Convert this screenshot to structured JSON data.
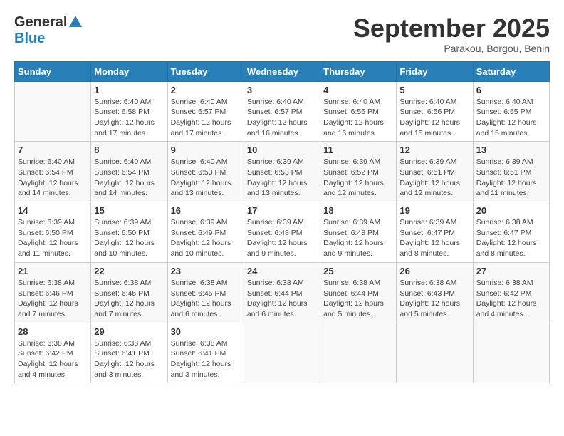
{
  "logo": {
    "general": "General",
    "blue": "Blue"
  },
  "title": {
    "month": "September 2025",
    "location": "Parakou, Borgou, Benin"
  },
  "headers": [
    "Sunday",
    "Monday",
    "Tuesday",
    "Wednesday",
    "Thursday",
    "Friday",
    "Saturday"
  ],
  "weeks": [
    [
      {
        "day": "",
        "info": ""
      },
      {
        "day": "1",
        "info": "Sunrise: 6:40 AM\nSunset: 6:58 PM\nDaylight: 12 hours\nand 17 minutes."
      },
      {
        "day": "2",
        "info": "Sunrise: 6:40 AM\nSunset: 6:57 PM\nDaylight: 12 hours\nand 17 minutes."
      },
      {
        "day": "3",
        "info": "Sunrise: 6:40 AM\nSunset: 6:57 PM\nDaylight: 12 hours\nand 16 minutes."
      },
      {
        "day": "4",
        "info": "Sunrise: 6:40 AM\nSunset: 6:56 PM\nDaylight: 12 hours\nand 16 minutes."
      },
      {
        "day": "5",
        "info": "Sunrise: 6:40 AM\nSunset: 6:56 PM\nDaylight: 12 hours\nand 15 minutes."
      },
      {
        "day": "6",
        "info": "Sunrise: 6:40 AM\nSunset: 6:55 PM\nDaylight: 12 hours\nand 15 minutes."
      }
    ],
    [
      {
        "day": "7",
        "info": ""
      },
      {
        "day": "8",
        "info": "Sunrise: 6:40 AM\nSunset: 6:54 PM\nDaylight: 12 hours\nand 14 minutes."
      },
      {
        "day": "9",
        "info": "Sunrise: 6:40 AM\nSunset: 6:53 PM\nDaylight: 12 hours\nand 13 minutes."
      },
      {
        "day": "10",
        "info": "Sunrise: 6:39 AM\nSunset: 6:53 PM\nDaylight: 12 hours\nand 13 minutes."
      },
      {
        "day": "11",
        "info": "Sunrise: 6:39 AM\nSunset: 6:52 PM\nDaylight: 12 hours\nand 12 minutes."
      },
      {
        "day": "12",
        "info": "Sunrise: 6:39 AM\nSunset: 6:51 PM\nDaylight: 12 hours\nand 12 minutes."
      },
      {
        "day": "13",
        "info": "Sunrise: 6:39 AM\nSunset: 6:51 PM\nDaylight: 12 hours\nand 11 minutes."
      }
    ],
    [
      {
        "day": "14",
        "info": ""
      },
      {
        "day": "15",
        "info": "Sunrise: 6:39 AM\nSunset: 6:50 PM\nDaylight: 12 hours\nand 10 minutes."
      },
      {
        "day": "16",
        "info": "Sunrise: 6:39 AM\nSunset: 6:49 PM\nDaylight: 12 hours\nand 10 minutes."
      },
      {
        "day": "17",
        "info": "Sunrise: 6:39 AM\nSunset: 6:48 PM\nDaylight: 12 hours\nand 9 minutes."
      },
      {
        "day": "18",
        "info": "Sunrise: 6:39 AM\nSunset: 6:48 PM\nDaylight: 12 hours\nand 9 minutes."
      },
      {
        "day": "19",
        "info": "Sunrise: 6:39 AM\nSunset: 6:47 PM\nDaylight: 12 hours\nand 8 minutes."
      },
      {
        "day": "20",
        "info": "Sunrise: 6:38 AM\nSunset: 6:47 PM\nDaylight: 12 hours\nand 8 minutes."
      }
    ],
    [
      {
        "day": "21",
        "info": ""
      },
      {
        "day": "22",
        "info": "Sunrise: 6:38 AM\nSunset: 6:45 PM\nDaylight: 12 hours\nand 7 minutes."
      },
      {
        "day": "23",
        "info": "Sunrise: 6:38 AM\nSunset: 6:45 PM\nDaylight: 12 hours\nand 6 minutes."
      },
      {
        "day": "24",
        "info": "Sunrise: 6:38 AM\nSunset: 6:44 PM\nDaylight: 12 hours\nand 6 minutes."
      },
      {
        "day": "25",
        "info": "Sunrise: 6:38 AM\nSunset: 6:44 PM\nDaylight: 12 hours\nand 5 minutes."
      },
      {
        "day": "26",
        "info": "Sunrise: 6:38 AM\nSunset: 6:43 PM\nDaylight: 12 hours\nand 5 minutes."
      },
      {
        "day": "27",
        "info": "Sunrise: 6:38 AM\nSunset: 6:42 PM\nDaylight: 12 hours\nand 4 minutes."
      }
    ],
    [
      {
        "day": "28",
        "info": "Sunrise: 6:38 AM\nSunset: 6:42 PM\nDaylight: 12 hours\nand 4 minutes."
      },
      {
        "day": "29",
        "info": "Sunrise: 6:38 AM\nSunset: 6:41 PM\nDaylight: 12 hours\nand 3 minutes."
      },
      {
        "day": "30",
        "info": "Sunrise: 6:38 AM\nSunset: 6:41 PM\nDaylight: 12 hours\nand 3 minutes."
      },
      {
        "day": "",
        "info": ""
      },
      {
        "day": "",
        "info": ""
      },
      {
        "day": "",
        "info": ""
      },
      {
        "day": "",
        "info": ""
      }
    ]
  ],
  "week7_14_21_info": [
    "Sunrise: 6:40 AM\nSunset: 6:54 PM\nDaylight: 12 hours\nand 14 minutes.",
    "Sunrise: 6:39 AM\nSunset: 6:50 PM\nDaylight: 12 hours\nand 11 minutes.",
    "Sunrise: 6:38 AM\nSunset: 6:46 PM\nDaylight: 12 hours\nand 7 minutes."
  ]
}
